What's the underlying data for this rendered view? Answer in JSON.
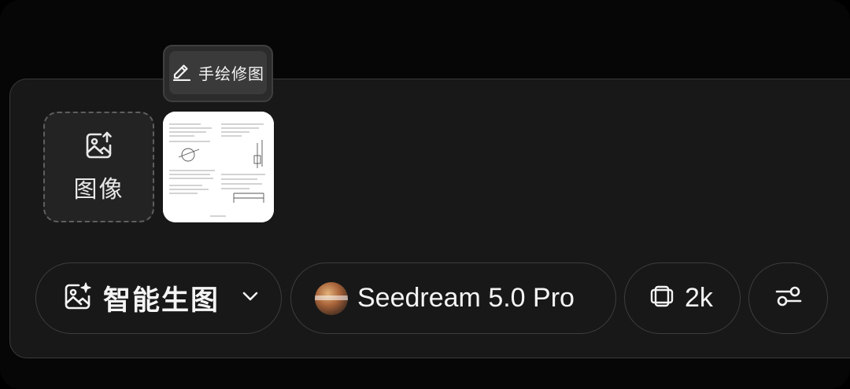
{
  "tooltip": {
    "label": "手绘修图",
    "icon": "pencil-icon"
  },
  "upload": {
    "label": "图像",
    "icon": "image-upload-icon"
  },
  "thumbnail": {
    "description_icon": "document-thumbnail"
  },
  "toolbar": {
    "mode": {
      "label": "智能生图",
      "icon": "image-sparkle-icon",
      "dropdown_icon": "chevron-down-icon"
    },
    "model": {
      "label": "Seedream 5.0 Pro",
      "icon": "model-avatar"
    },
    "resolution": {
      "label": "2k",
      "icon": "aspect-ratio-icon"
    },
    "settings": {
      "icon": "sliders-icon"
    }
  },
  "colors": {
    "background": "#000000",
    "panel": "#181818",
    "border": "#3a3a3a",
    "text": "#ffffff"
  }
}
